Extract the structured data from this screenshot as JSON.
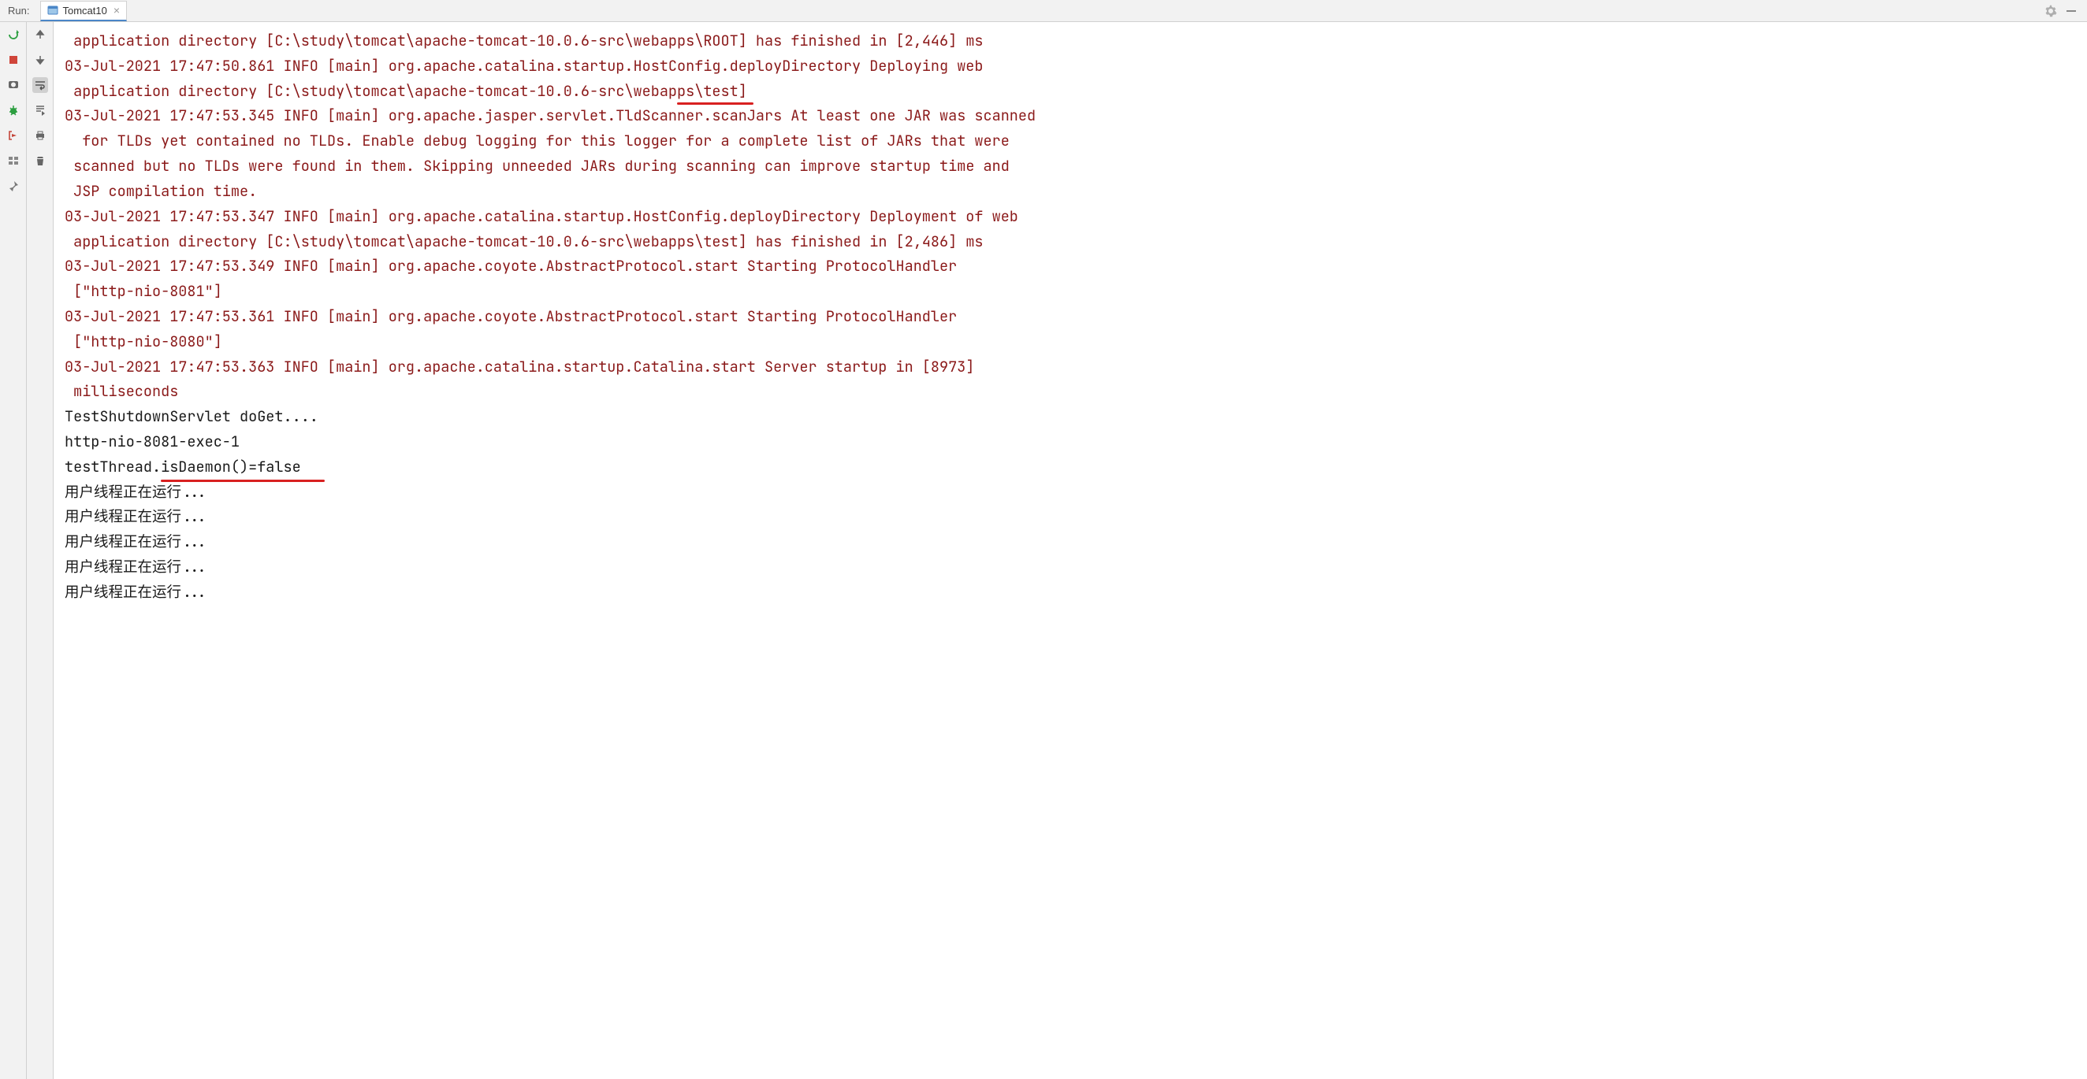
{
  "header": {
    "run_label": "Run:",
    "tab_name": "Tomcat10",
    "tab_close": "×"
  },
  "console": {
    "lines": [
      {
        "cls": "log-red",
        "text": " application directory [C:\\study\\tomcat\\apache-tomcat-10.0.6-src\\webapps\\ROOT] has finished in [2,446] ms"
      },
      {
        "cls": "log-red",
        "text": "03-Jul-2021 17:47:50.861 INFO [main] org.apache.catalina.startup.HostConfig.deployDirectory Deploying web"
      },
      {
        "cls": "log-red",
        "pre": " application directory [C:\\study\\tomcat\\apache-tomcat-10.0.6-src\\webap",
        "under": "ps\\test]",
        "under_cls": "underline-red"
      },
      {
        "cls": "log-red",
        "text": "03-Jul-2021 17:47:53.345 INFO [main] org.apache.jasper.servlet.TldScanner.scanJars At least one JAR was scanned"
      },
      {
        "cls": "log-red",
        "text": "  for TLDs yet contained no TLDs. Enable debug logging for this logger for a complete list of JARs that were"
      },
      {
        "cls": "log-red",
        "text": " scanned but no TLDs were found in them. Skipping unneeded JARs during scanning can improve startup time and"
      },
      {
        "cls": "log-red",
        "text": " JSP compilation time."
      },
      {
        "cls": "log-red",
        "text": "03-Jul-2021 17:47:53.347 INFO [main] org.apache.catalina.startup.HostConfig.deployDirectory Deployment of web"
      },
      {
        "cls": "log-red",
        "text": " application directory [C:\\study\\tomcat\\apache-tomcat-10.0.6-src\\webapps\\test] has finished in [2,486] ms"
      },
      {
        "cls": "log-red",
        "text": "03-Jul-2021 17:47:53.349 INFO [main] org.apache.coyote.AbstractProtocol.start Starting ProtocolHandler"
      },
      {
        "cls": "log-red",
        "text": " [\"http-nio-8081\"]"
      },
      {
        "cls": "log-red",
        "text": "03-Jul-2021 17:47:53.361 INFO [main] org.apache.coyote.AbstractProtocol.start Starting ProtocolHandler"
      },
      {
        "cls": "log-red",
        "text": " [\"http-nio-8080\"]"
      },
      {
        "cls": "log-red",
        "text": "03-Jul-2021 17:47:53.363 INFO [main] org.apache.catalina.startup.Catalina.start Server startup in [8973]"
      },
      {
        "cls": "log-red",
        "text": " milliseconds"
      },
      {
        "cls": "log-black",
        "text": "TestShutdownServlet doGet...."
      },
      {
        "cls": "log-black",
        "text": "http-nio-8081-exec-1"
      },
      {
        "cls": "log-black",
        "pre": "testThread.",
        "under": "isDaemon()=false",
        "under_cls": "underline-red2"
      },
      {
        "cls": "log-black",
        "text": "用户线程正在运行..."
      },
      {
        "cls": "log-black",
        "text": "用户线程正在运行..."
      },
      {
        "cls": "log-black",
        "text": "用户线程正在运行..."
      },
      {
        "cls": "log-black",
        "text": "用户线程正在运行..."
      },
      {
        "cls": "log-black",
        "text": "用户线程正在运行..."
      }
    ]
  }
}
